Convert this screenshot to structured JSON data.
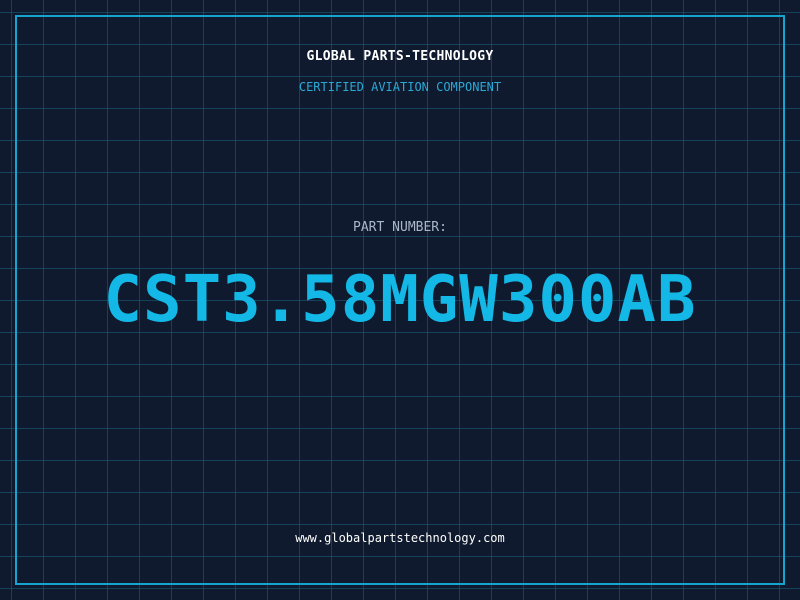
{
  "header": {
    "company": "GLOBAL PARTS-TECHNOLOGY",
    "subtitle": "CERTIFIED AVIATION COMPONENT"
  },
  "main": {
    "label": "PART NUMBER:",
    "part_number": "CST3.58MGW300AB"
  },
  "footer": {
    "website": "www.globalpartstechnology.com"
  },
  "colors": {
    "background": "#0f1a2e",
    "grid": "#1a6080",
    "accent": "#13b8e6",
    "frame": "#17a3cf"
  }
}
